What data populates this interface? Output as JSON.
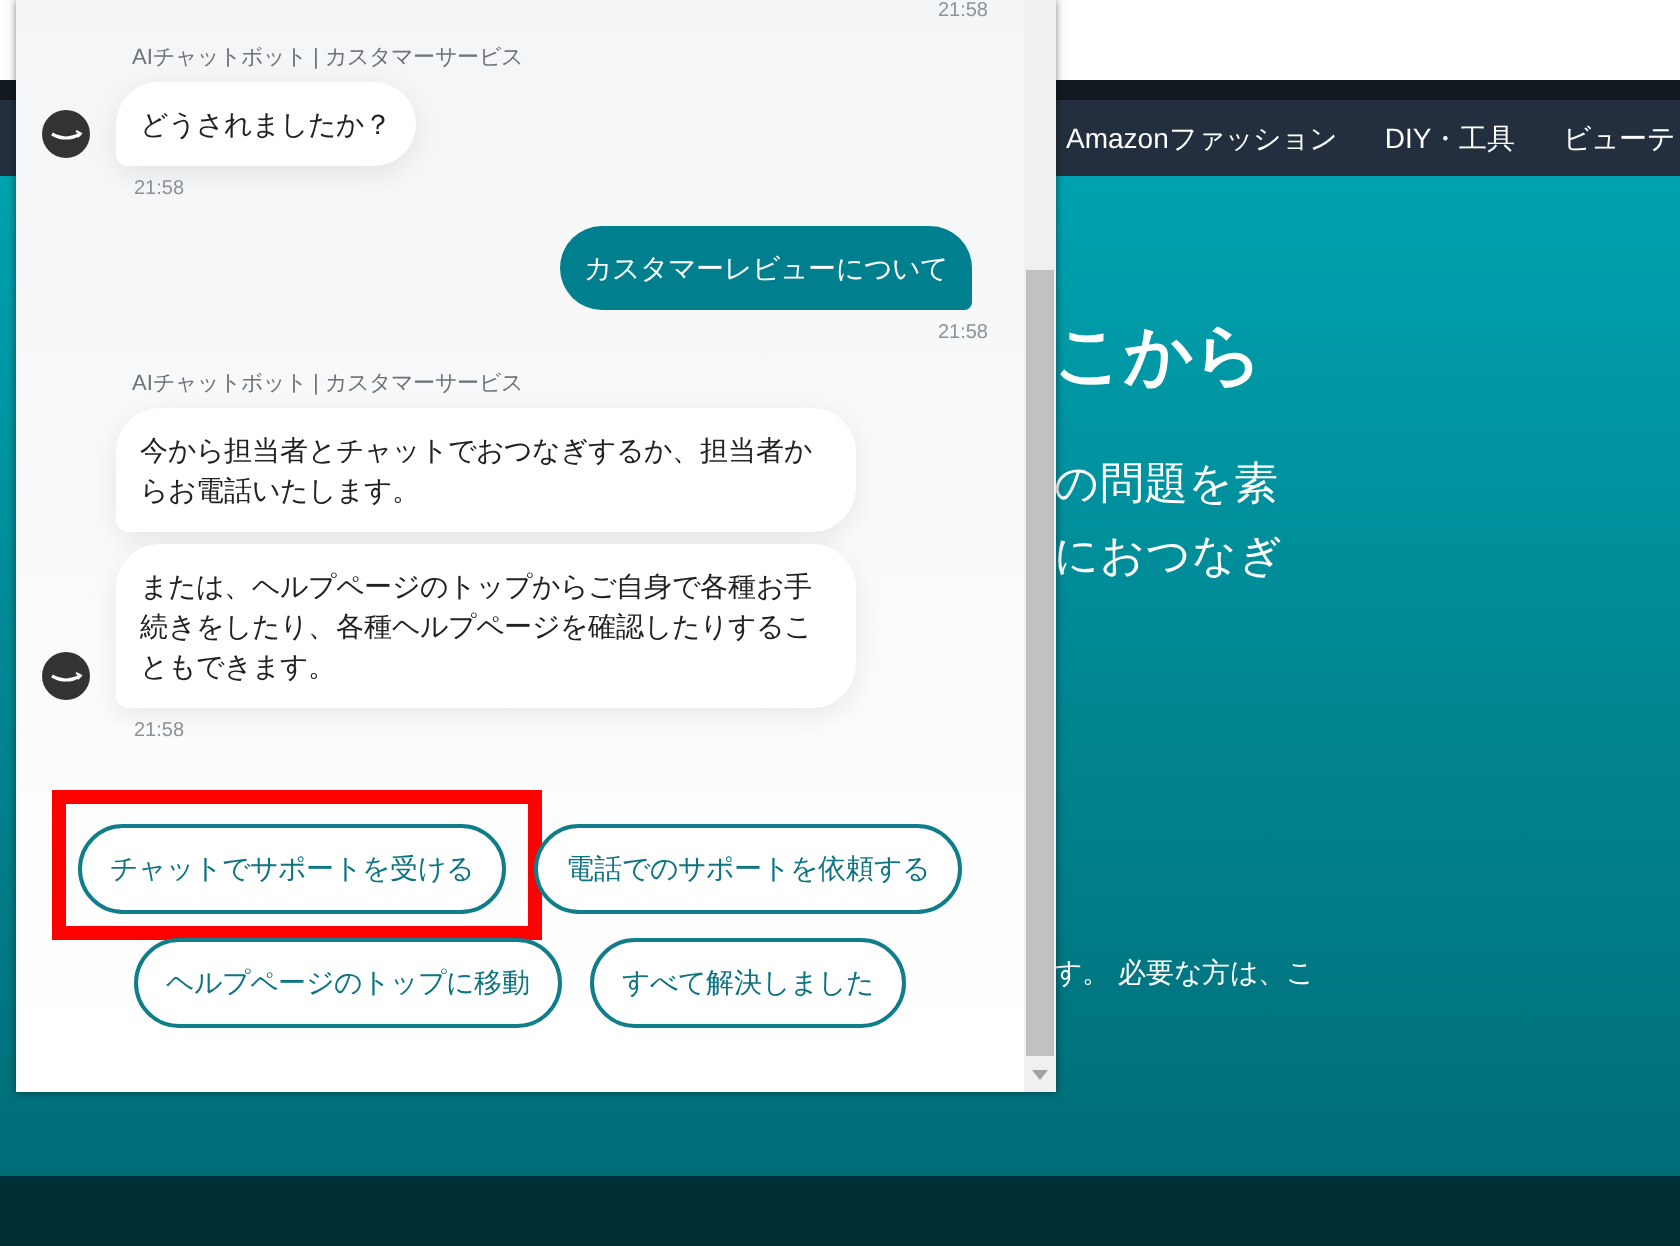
{
  "page": {
    "nav_items": [
      "Amazonファッション",
      "DIY・工具",
      "ビューテ"
    ],
    "hero": {
      "heading": "こから",
      "body_lines": [
        "の問題を素",
        "におつなぎ"
      ],
      "note": "す。 必要な方は、こ"
    }
  },
  "chat": {
    "top_time": "21:58",
    "messages": [
      {
        "kind": "bot",
        "sender": "AIチャットボット | カスタマーサービス",
        "bubbles": [
          "どうされましたか？"
        ],
        "time": "21:58"
      },
      {
        "kind": "user",
        "bubbles": [
          "カスタマーレビューについて"
        ],
        "time": "21:58"
      },
      {
        "kind": "bot",
        "sender": "AIチャットボット | カスタマーサービス",
        "bubbles": [
          "今から担当者とチャットでおつなぎするか、担当者からお電話いたします。",
          "または、ヘルプページのトップからご自身で各種お手続きをしたり、各種ヘルプページを確認したりすることもできます。"
        ],
        "time": "21:58"
      }
    ],
    "options": [
      {
        "label": "チャットでサポートを受ける",
        "highlighted": true
      },
      {
        "label": "電話でのサポートを依頼する",
        "highlighted": false
      },
      {
        "label": "ヘルプページのトップに移動",
        "highlighted": false
      },
      {
        "label": "すべて解決しました",
        "highlighted": false
      }
    ]
  }
}
